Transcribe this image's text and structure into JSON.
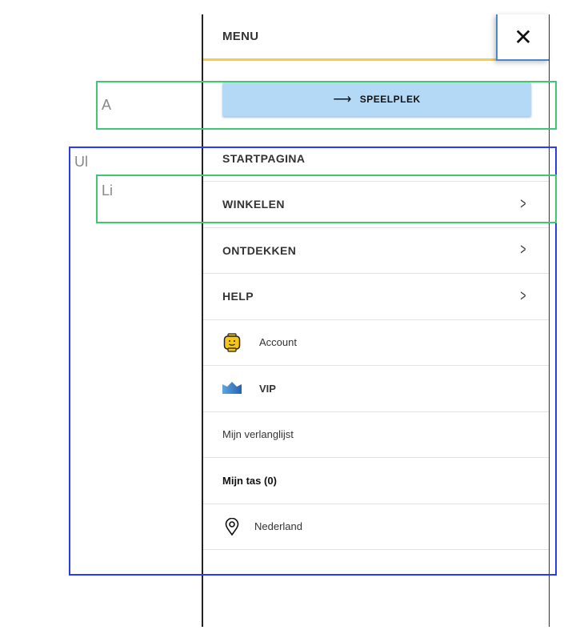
{
  "header": {
    "title": "MENU",
    "close_icon": "close-icon"
  },
  "cta": {
    "label": "SPEELPLEK",
    "icon": "arrow-right-icon"
  },
  "menu_items": [
    {
      "label": "STARTPAGINA"
    },
    {
      "label": "WINKELEN"
    },
    {
      "label": "ONTDEKKEN"
    },
    {
      "label": "HELP"
    },
    {
      "label": "Account"
    },
    {
      "label": "VIP"
    },
    {
      "label": "Mijn verlanglijst"
    },
    {
      "label": "Mijn tas (0)"
    },
    {
      "label": "Nederland"
    }
  ],
  "overlays": {
    "a": "A",
    "ul": "Ul",
    "li": "Li"
  },
  "colors": {
    "accent_yellow": "#f5cd47",
    "button_blue": "#b3d9f7",
    "overlay_green": "#3ec873",
    "overlay_blue": "#2b3cf0"
  }
}
